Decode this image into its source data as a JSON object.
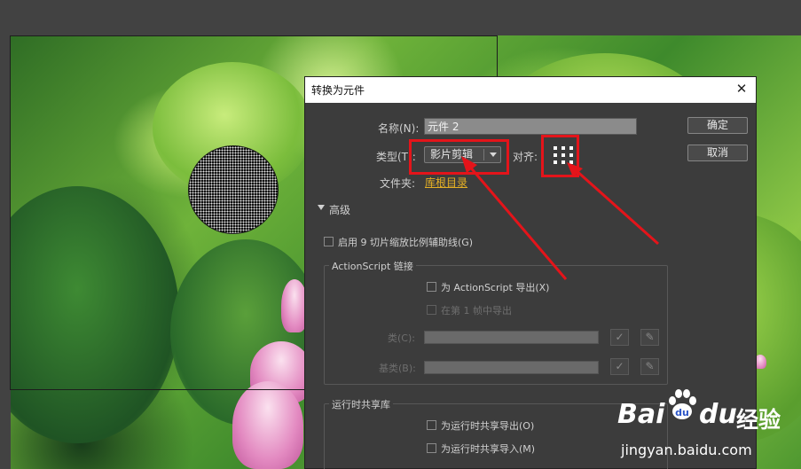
{
  "dialog": {
    "title": "转换为元件",
    "close_glyph": "✕",
    "name_label": "名称(N):",
    "name_value": "元件 2",
    "type_label": "类型(T):",
    "type_value": "影片剪辑",
    "align_label": "对齐:",
    "folder_label": "文件夹:",
    "folder_value": "库根目录",
    "ok_label": "确定",
    "cancel_label": "取消",
    "advanced_label": "高级",
    "nine_slice_label": "启用 9 切片缩放比例辅助线(G)",
    "actionscript_group": "ActionScript 链接",
    "export_as_label": "为 ActionScript 导出(X)",
    "export_frame_label": "在第 1 帧中导出",
    "class_label": "类(C):",
    "base_class_label": "基类(B):",
    "rsl_group": "运行时共享库",
    "rsl_export_label": "为运行时共享导出(O)",
    "rsl_import_label": "为运行时共享导入(M)"
  },
  "watermark": {
    "brand_a": "Bai",
    "brand_b": "du",
    "brand_cn": "经验",
    "url": "jingyan.baidu.com"
  },
  "colors": {
    "annotation_red": "#e4141a",
    "link_orange": "#e5b025",
    "dialog_bg": "#3c3c3c"
  }
}
